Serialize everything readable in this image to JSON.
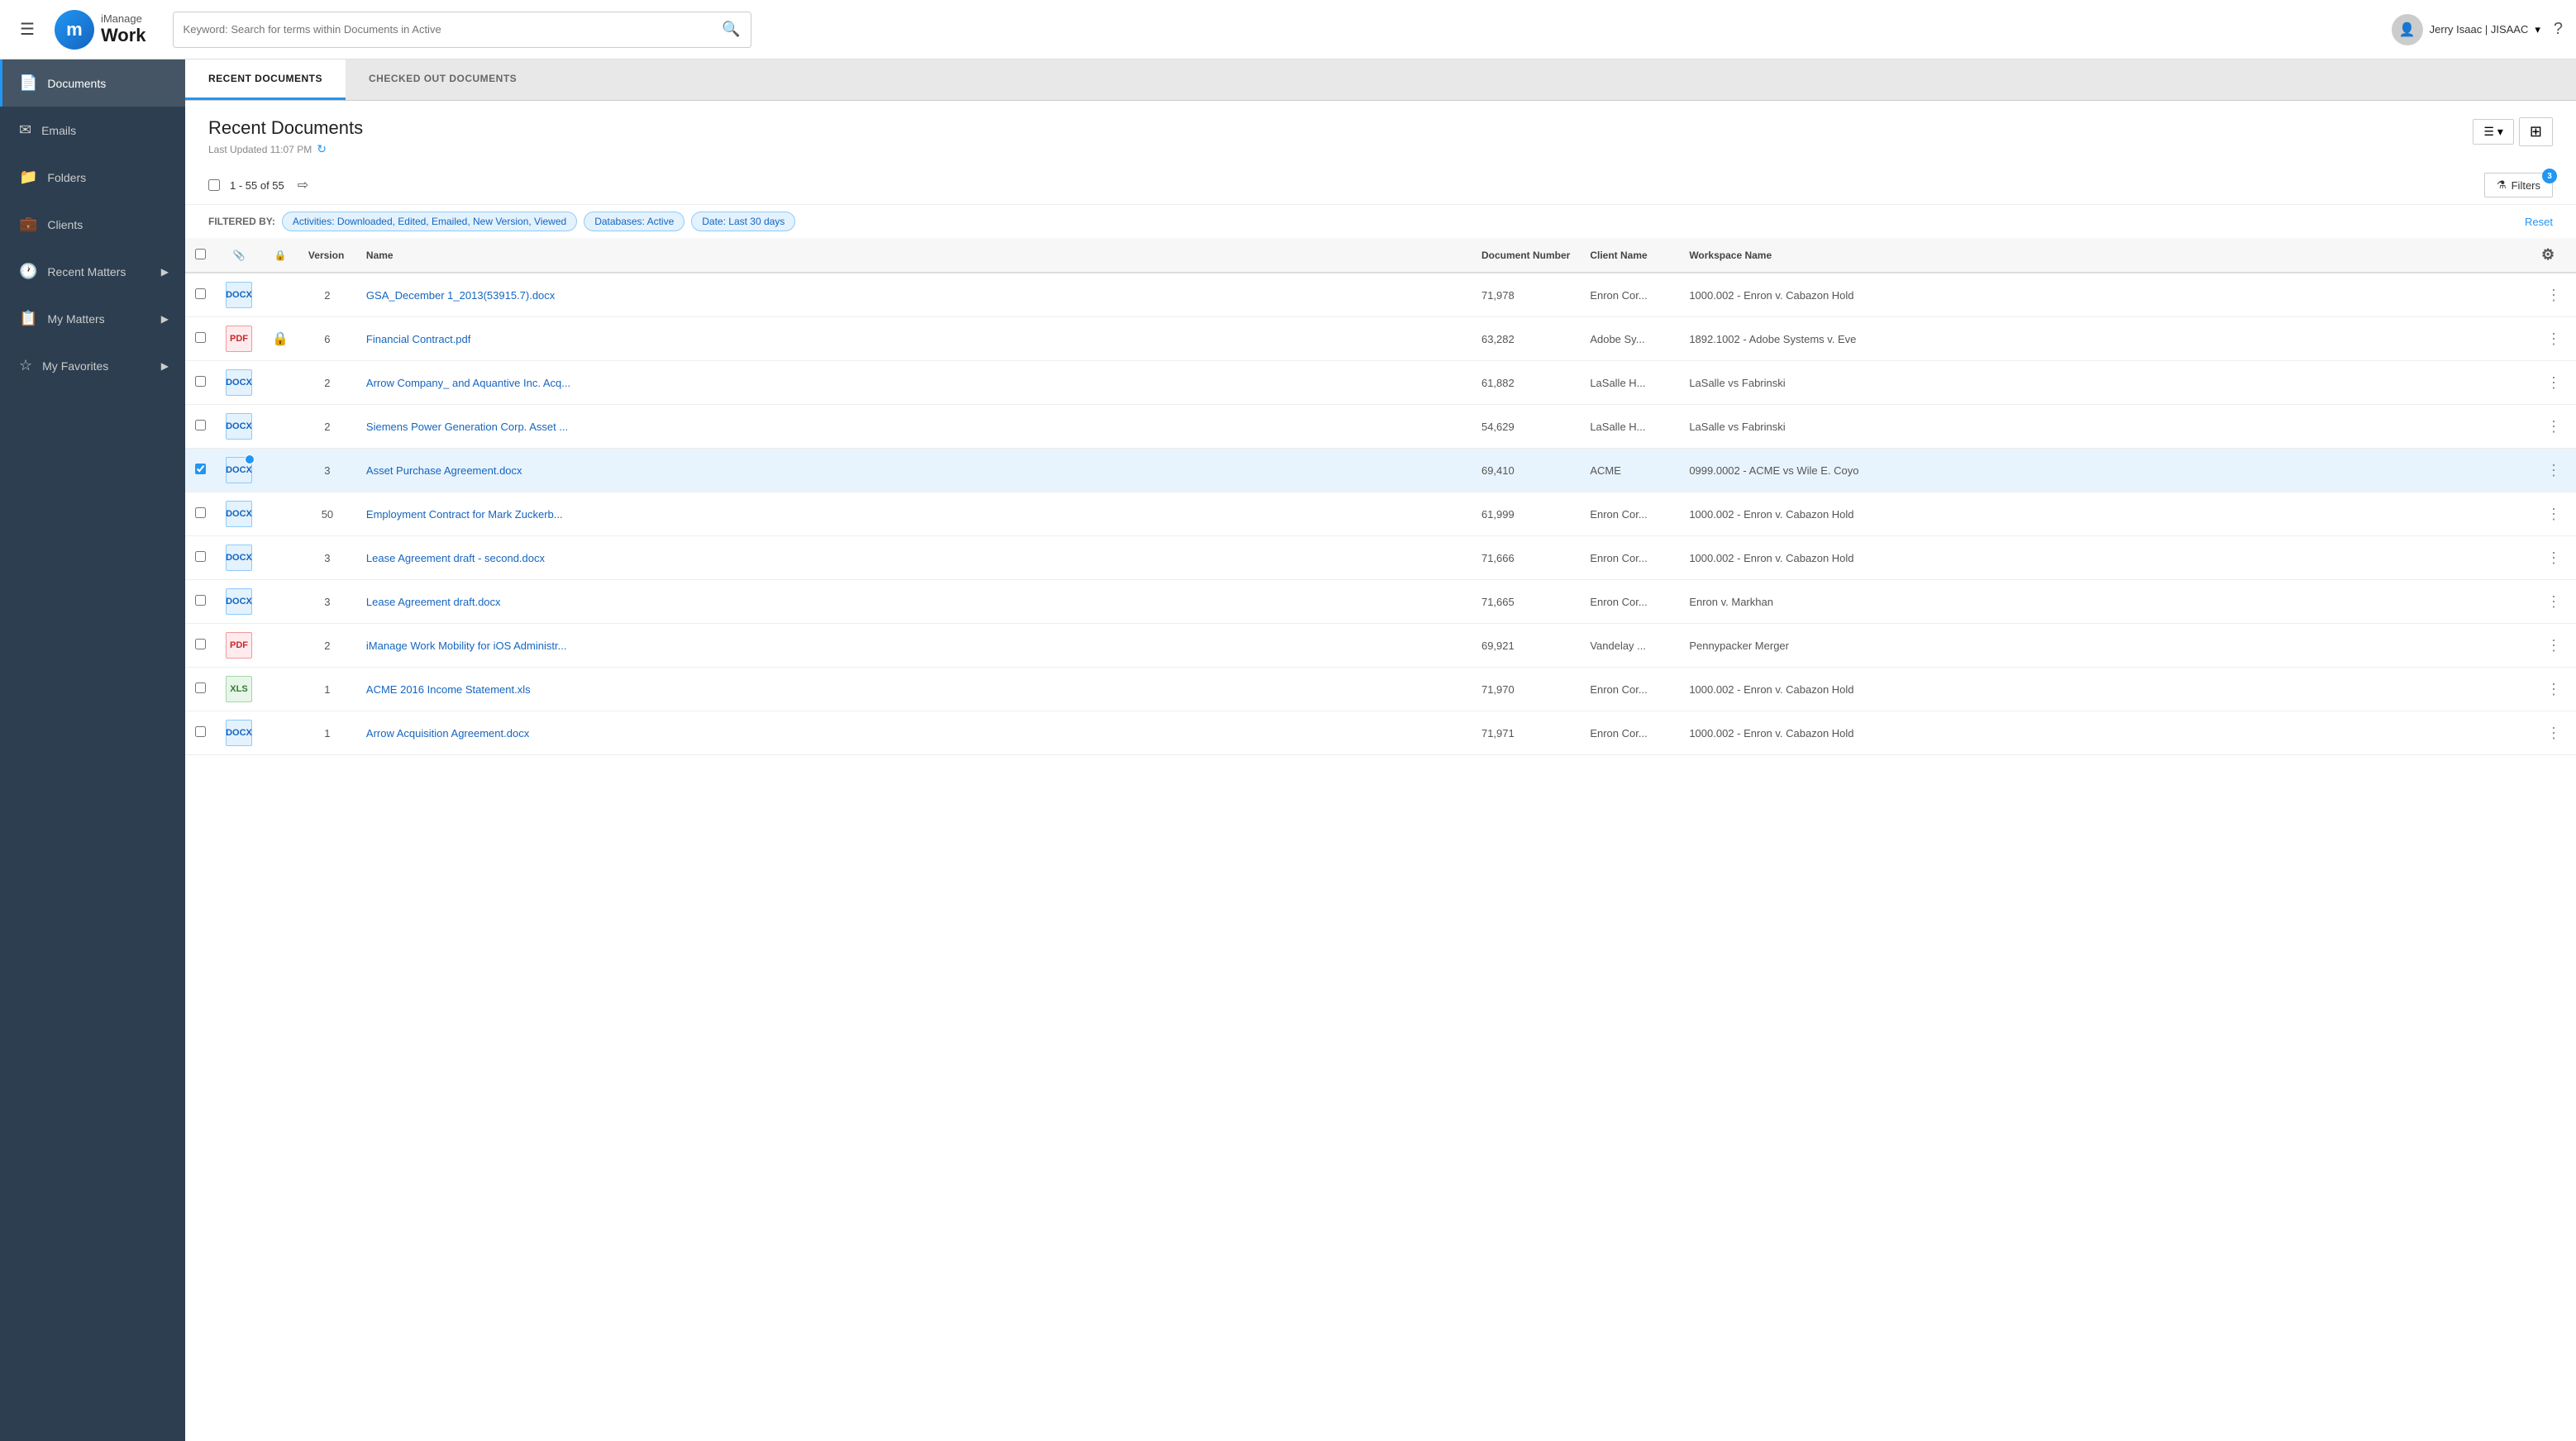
{
  "topbar": {
    "hamburger_label": "☰",
    "logo_letter": "m",
    "logo_imanage": "iManage",
    "logo_work": "Work",
    "search_placeholder": "Keyword: Search for terms within Documents in Active",
    "user_name": "Jerry Isaac  |  JISAAC",
    "help_icon": "?"
  },
  "sidebar": {
    "items": [
      {
        "id": "documents",
        "label": "Documents",
        "icon": "📄",
        "active": true
      },
      {
        "id": "emails",
        "label": "Emails",
        "icon": "✉"
      },
      {
        "id": "folders",
        "label": "Folders",
        "icon": "📁"
      },
      {
        "id": "clients",
        "label": "Clients",
        "icon": "💼"
      },
      {
        "id": "recent-matters",
        "label": "Recent Matters",
        "icon": "🕐",
        "expandable": true
      },
      {
        "id": "my-matters",
        "label": "My Matters",
        "icon": "📋",
        "expandable": true
      },
      {
        "id": "my-favorites",
        "label": "My Favorites",
        "icon": "☆",
        "expandable": true
      }
    ]
  },
  "tabs": [
    {
      "id": "recent-documents",
      "label": "RECENT DOCUMENTS",
      "active": true
    },
    {
      "id": "checked-out-documents",
      "label": "CHECKED OUT DOCUMENTS",
      "active": false
    }
  ],
  "content": {
    "title": "Recent Documents",
    "subtitle": "Last Updated 11:07 PM",
    "refresh_icon": "↻",
    "count_label": "1 - 55 of 55",
    "export_icon": "⇨",
    "filter_btn_label": "Filters",
    "filter_count": "3",
    "filter_by_label": "FILTERED BY:",
    "filters": [
      {
        "label": "Activities: Downloaded, Edited, Emailed, New Version, Viewed"
      },
      {
        "label": "Databases: Active"
      },
      {
        "label": "Date: Last 30 days"
      }
    ],
    "reset_label": "Reset"
  },
  "table": {
    "columns": [
      {
        "id": "check",
        "label": ""
      },
      {
        "id": "attachment",
        "label": "📎"
      },
      {
        "id": "lock",
        "label": "🔒"
      },
      {
        "id": "version",
        "label": "Version"
      },
      {
        "id": "name",
        "label": "Name"
      },
      {
        "id": "docnum",
        "label": "Document Number"
      },
      {
        "id": "client",
        "label": "Client Name"
      },
      {
        "id": "workspace",
        "label": "Workspace Name"
      },
      {
        "id": "settings",
        "label": "⚙"
      }
    ],
    "rows": [
      {
        "id": 1,
        "type": "docx",
        "has_badge": false,
        "locked": false,
        "version": 2,
        "name": "GSA_December 1_2013(53915.7).docx",
        "doc_num": "71,978",
        "client": "Enron Cor...",
        "workspace": "1000.002 - Enron v. Cabazon Hold",
        "selected": false
      },
      {
        "id": 2,
        "type": "pdf",
        "has_badge": false,
        "locked": true,
        "version": 6,
        "name": "Financial Contract.pdf",
        "doc_num": "63,282",
        "client": "Adobe Sy...",
        "workspace": "1892.1002 - Adobe Systems v. Eve",
        "selected": false
      },
      {
        "id": 3,
        "type": "docx",
        "has_badge": false,
        "locked": false,
        "version": 2,
        "name": "Arrow Company_ and Aquantive Inc. Acq...",
        "doc_num": "61,882",
        "client": "LaSalle H...",
        "workspace": "LaSalle vs Fabrinski",
        "selected": false
      },
      {
        "id": 4,
        "type": "docx",
        "has_badge": false,
        "locked": false,
        "version": 2,
        "name": "Siemens Power Generation Corp. Asset ...",
        "doc_num": "54,629",
        "client": "LaSalle H...",
        "workspace": "LaSalle vs Fabrinski",
        "selected": false
      },
      {
        "id": 5,
        "type": "docx",
        "has_badge": true,
        "locked": false,
        "version": 3,
        "name": "Asset Purchase Agreement.docx",
        "doc_num": "69,410",
        "client": "ACME",
        "workspace": "0999.0002 - ACME vs Wile E. Coyo",
        "selected": true
      },
      {
        "id": 6,
        "type": "docx",
        "has_badge": false,
        "locked": false,
        "version": 50,
        "name": "Employment Contract for Mark Zuckerb...",
        "doc_num": "61,999",
        "client": "Enron Cor...",
        "workspace": "1000.002 - Enron v. Cabazon Hold",
        "selected": false
      },
      {
        "id": 7,
        "type": "docx",
        "has_badge": false,
        "locked": false,
        "version": 3,
        "name": "Lease Agreement draft - second.docx",
        "doc_num": "71,666",
        "client": "Enron Cor...",
        "workspace": "1000.002 - Enron v. Cabazon Hold",
        "selected": false
      },
      {
        "id": 8,
        "type": "docx",
        "has_badge": false,
        "locked": false,
        "version": 3,
        "name": "Lease Agreement draft.docx",
        "doc_num": "71,665",
        "client": "Enron Cor...",
        "workspace": "Enron v. Markhan",
        "selected": false
      },
      {
        "id": 9,
        "type": "pdf",
        "has_badge": false,
        "locked": false,
        "version": 2,
        "name": "iManage Work Mobility for iOS Administr...",
        "doc_num": "69,921",
        "client": "Vandelay ...",
        "workspace": "Pennypacker Merger",
        "selected": false
      },
      {
        "id": 10,
        "type": "xls",
        "has_badge": false,
        "locked": false,
        "version": 1,
        "name": "ACME 2016 Income Statement.xls",
        "doc_num": "71,970",
        "client": "Enron Cor...",
        "workspace": "1000.002 - Enron v. Cabazon Hold",
        "selected": false
      },
      {
        "id": 11,
        "type": "docx",
        "has_badge": false,
        "locked": false,
        "version": 1,
        "name": "Arrow Acquisition Agreement.docx",
        "doc_num": "71,971",
        "client": "Enron Cor...",
        "workspace": "1000.002 - Enron v. Cabazon Hold",
        "selected": false
      }
    ]
  }
}
